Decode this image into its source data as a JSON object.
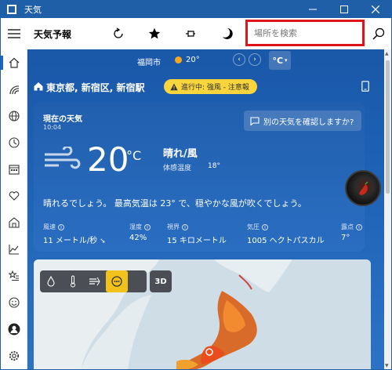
{
  "app": {
    "title": "天気"
  },
  "toolbar": {
    "app_name": "天気予報",
    "search_placeholder": "場所を検索"
  },
  "citybar": {
    "city": "福岡市",
    "temp": "20°",
    "unit": "°C"
  },
  "location": {
    "name": "東京都, 新宿区, 新宿駅",
    "alert": "進行中: 強風 - 注意報"
  },
  "current": {
    "label": "現在の天気",
    "time": "10:04",
    "other_weather": "別の天気を確認しますか?",
    "temp": "20",
    "unit": "°C",
    "condition": "晴れ/風",
    "feels_label": "体感温度",
    "feels_value": "18°",
    "summary": "晴れるでしょう。 最高気温は 23° で、穏やかな風が吹くでしょう。",
    "stats": [
      {
        "label": "風速",
        "value": "11 メートル/秒"
      },
      {
        "label": "湿度",
        "value": "42%"
      },
      {
        "label": "視界",
        "value": "15 キロメートル"
      },
      {
        "label": "気圧",
        "value": "1005 ヘクトパスカル"
      },
      {
        "label": "露点",
        "value": "7°"
      }
    ]
  },
  "map": {
    "btn_3d": "3D"
  },
  "icons": {
    "nav": [
      "home-icon",
      "forecast-icon",
      "globe-icon",
      "history-icon",
      "calendar-icon",
      "heart-icon",
      "house-icon",
      "chart-icon",
      "star-list-icon",
      "smile-icon",
      "avatar",
      "settings-icon"
    ]
  },
  "colors": {
    "alert_bg": "#f8d53c",
    "search_highlight": "#e0121a",
    "accent": "#1a66c6"
  }
}
